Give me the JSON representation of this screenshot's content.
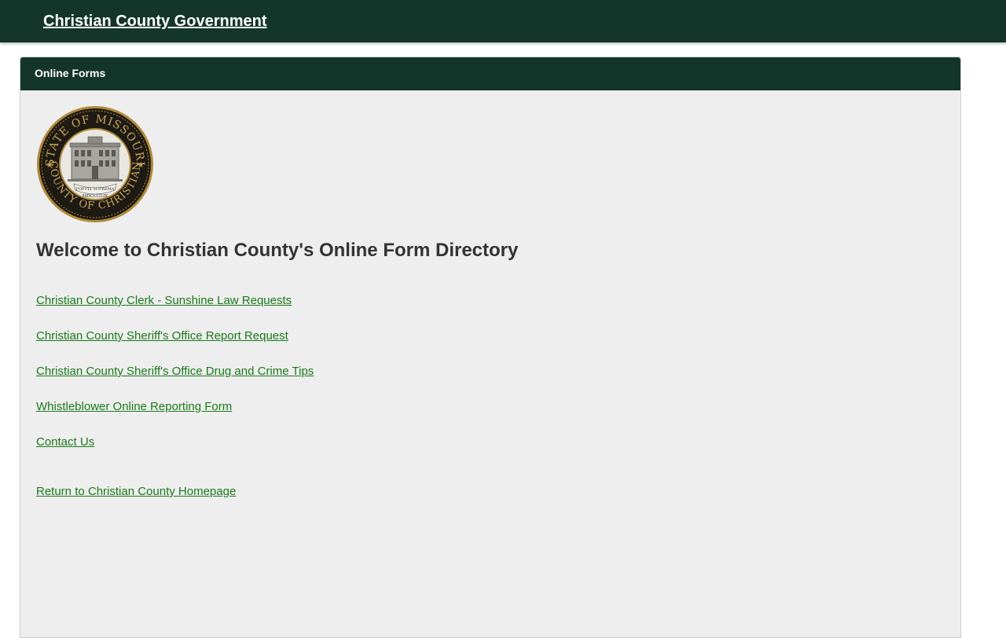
{
  "header": {
    "site_title": "Christian County Government"
  },
  "panel": {
    "title": "Online Forms",
    "seal": {
      "top_text": "STATE OF MISSOURI",
      "bottom_text": "COUNTY OF CHRISTIAN",
      "ribbon_text": "POPULI SUPREMA",
      "year": "MDCCCLIX"
    },
    "welcome_heading": "Welcome to Christian County's Online Form Directory",
    "links": [
      "Christian County Clerk - Sunshine Law Requests",
      "Christian County Sheriff's Office Report Request",
      "Christian County Sheriff's Office Drug and Crime Tips",
      "Whistleblower Online Reporting Form",
      "Contact Us"
    ],
    "return_link": "Return to Christian County Homepage"
  },
  "colors": {
    "header_bg": "#14352a",
    "panel_bg": "#eeeeee",
    "link": "#1a7a1a",
    "heading": "#333333",
    "seal_gold": "#b08a3a",
    "seal_dark": "#1e1a14"
  }
}
